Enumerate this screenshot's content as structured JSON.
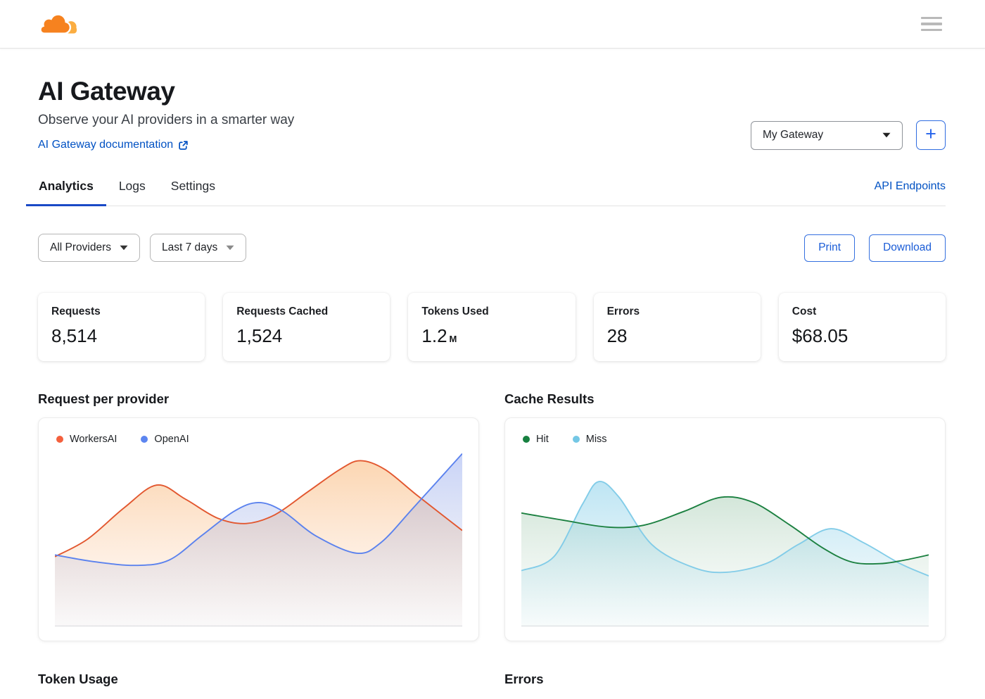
{
  "topbar": {
    "logo_name": "Cloudflare",
    "menu_icon": "hamburger-menu"
  },
  "header": {
    "title": "AI Gateway",
    "subtitle": "Observe your AI providers in a smarter way",
    "doc_link_label": "AI Gateway documentation",
    "gateway_selector_value": "My Gateway",
    "add_gateway_label": "+"
  },
  "tabs": {
    "items": [
      {
        "label": "Analytics",
        "active": true
      },
      {
        "label": "Logs",
        "active": false
      },
      {
        "label": "Settings",
        "active": false
      }
    ],
    "right_link": "API Endpoints"
  },
  "filters": {
    "provider_value": "All Providers",
    "date_range_value": "Last 7 days",
    "print_label": "Print",
    "download_label": "Download"
  },
  "stats": [
    {
      "label": "Requests",
      "value": "8,514"
    },
    {
      "label": "Requests Cached",
      "value": "1,524"
    },
    {
      "label": "Tokens Used",
      "value": "1.2",
      "suffix": "M"
    },
    {
      "label": "Errors",
      "value": "28"
    },
    {
      "label": "Cost",
      "value": "$68.05"
    }
  ],
  "sections": {
    "bottom_left_title": "Token Usage",
    "bottom_right_title": "Errors"
  },
  "colors": {
    "accent_blue": "#0051c3",
    "button_blue": "#1a5cd7",
    "tab_underline": "#1949c6",
    "cloudflare_orange": "#F6821F",
    "cloudflare_light_orange": "#FBAD41",
    "workersai": "#F4603D",
    "openai": "#5C85F0",
    "hit_green": "#178040",
    "miss_blue": "#74C7E5"
  },
  "chart_data": [
    {
      "type": "area",
      "title": "Request per provider",
      "x_note": "Last 7 days, no axis tick labels shown",
      "y_note": "no axis tick labels shown; values normalized 0-100 estimated from pixel heights",
      "legend_position": "top-left",
      "grid": false,
      "series": [
        {
          "name": "WorkersAI",
          "line_color": "#E2572F",
          "dot_color": "#F4603D",
          "fill_top": "rgba(247,147,52,0.38)",
          "fill_bottom": "rgba(247,170,110,0.02)",
          "line_on_top": false,
          "points": [
            [
              0,
              40
            ],
            [
              8,
              50
            ],
            [
              17,
              68
            ],
            [
              25,
              81
            ],
            [
              32,
              73
            ],
            [
              40,
              62
            ],
            [
              47,
              59
            ],
            [
              54,
              64
            ],
            [
              62,
              77
            ],
            [
              70,
              90
            ],
            [
              75,
              95
            ],
            [
              81,
              90
            ],
            [
              89,
              75
            ],
            [
              100,
              55
            ]
          ]
        },
        {
          "name": "OpenAI",
          "line_color": "#5B82EE",
          "dot_color": "#5C85F0",
          "fill_top": "rgba(112,140,235,0.38)",
          "fill_bottom": "rgba(170,178,210,0.06)",
          "line_on_top": true,
          "points": [
            [
              0,
              41
            ],
            [
              10,
              37
            ],
            [
              20,
              35
            ],
            [
              28,
              38
            ],
            [
              36,
              52
            ],
            [
              44,
              66
            ],
            [
              50,
              71
            ],
            [
              56,
              66
            ],
            [
              64,
              52
            ],
            [
              74,
              42
            ],
            [
              80,
              48
            ],
            [
              88,
              68
            ],
            [
              100,
              99
            ]
          ]
        }
      ]
    },
    {
      "type": "area",
      "title": "Cache Results",
      "x_note": "Last 7 days, no axis tick labels shown",
      "y_note": "no axis tick labels shown; values normalized 0-100 estimated from pixel heights",
      "legend_position": "top-left",
      "grid": false,
      "series": [
        {
          "name": "Hit",
          "line_color": "#1B8040",
          "dot_color": "#178040",
          "fill_top": "rgba(34,130,66,0.20)",
          "fill_bottom": "rgba(130,180,150,0.02)",
          "line_on_top": true,
          "points": [
            [
              0,
              65
            ],
            [
              10,
              61
            ],
            [
              21,
              57
            ],
            [
              30,
              58
            ],
            [
              40,
              66
            ],
            [
              49,
              74
            ],
            [
              57,
              71
            ],
            [
              66,
              58
            ],
            [
              74,
              45
            ],
            [
              81,
              37
            ],
            [
              88,
              36
            ],
            [
              94,
              38
            ],
            [
              100,
              41
            ]
          ]
        },
        {
          "name": "Miss",
          "line_color": "#82CCE8",
          "dot_color": "#74C7E5",
          "fill_top": "rgba(125,203,232,0.50)",
          "fill_bottom": "rgba(160,215,230,0.06)",
          "line_on_top": false,
          "points": [
            [
              0,
              32
            ],
            [
              8,
              40
            ],
            [
              15,
              70
            ],
            [
              19,
              83
            ],
            [
              24,
              74
            ],
            [
              32,
              47
            ],
            [
              42,
              34
            ],
            [
              50,
              31
            ],
            [
              60,
              36
            ],
            [
              68,
              47
            ],
            [
              76,
              56
            ],
            [
              84,
              48
            ],
            [
              93,
              36
            ],
            [
              100,
              29
            ]
          ]
        }
      ]
    }
  ]
}
